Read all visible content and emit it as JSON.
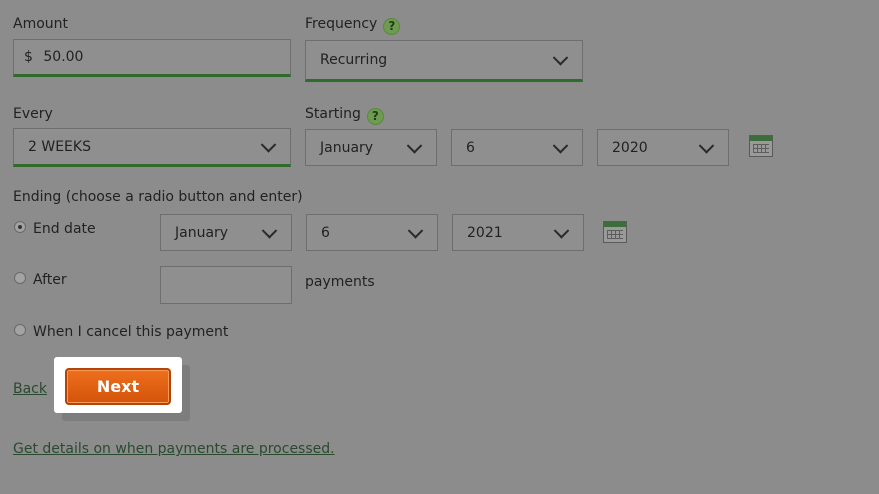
{
  "amount": {
    "label": "Amount",
    "currency_symbol": "$",
    "value": "50.00"
  },
  "frequency": {
    "label": "Frequency",
    "help": "?",
    "value": "Recurring"
  },
  "every": {
    "label": "Every",
    "value": "2 WEEKS"
  },
  "starting": {
    "label": "Starting",
    "help": "?",
    "month": "January",
    "day": "6",
    "year": "2020"
  },
  "ending": {
    "label": "Ending (choose a radio button and enter)",
    "end_date": {
      "label": "End date",
      "checked": true,
      "month": "January",
      "day": "6",
      "year": "2021"
    },
    "after": {
      "label": "After",
      "checked": false,
      "value": "",
      "suffix": "payments"
    },
    "cancel": {
      "label": "When I cancel this payment",
      "checked": false
    }
  },
  "actions": {
    "back": "Back",
    "next": "Next"
  },
  "footer_link": "Get details on when payments are processed.",
  "colors": {
    "accent_green": "#2f6b2a",
    "next_orange": "#e2621a",
    "overlay": "#8c8c8c"
  },
  "icons": {
    "help": "help-circle-icon",
    "calendar": "calendar-icon",
    "dropdown": "chevron-down-icon"
  }
}
